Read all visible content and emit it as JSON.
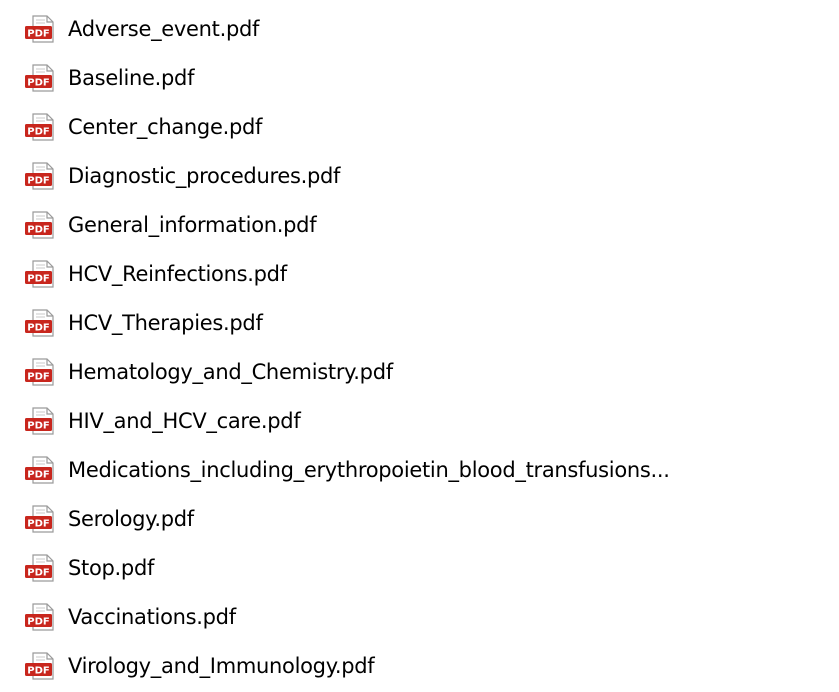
{
  "files": [
    {
      "name": "Adverse_event.pdf",
      "icon": "pdf-file-icon"
    },
    {
      "name": "Baseline.pdf",
      "icon": "pdf-file-icon"
    },
    {
      "name": "Center_change.pdf",
      "icon": "pdf-file-icon"
    },
    {
      "name": "Diagnostic_procedures.pdf",
      "icon": "pdf-file-icon"
    },
    {
      "name": "General_information.pdf",
      "icon": "pdf-file-icon"
    },
    {
      "name": "HCV_Reinfections.pdf",
      "icon": "pdf-file-icon"
    },
    {
      "name": "HCV_Therapies.pdf",
      "icon": "pdf-file-icon"
    },
    {
      "name": "Hematology_and_Chemistry.pdf",
      "icon": "pdf-file-icon"
    },
    {
      "name": "HIV_and_HCV_care.pdf",
      "icon": "pdf-file-icon"
    },
    {
      "name": "Medications_including_erythropoietin_blood_transfusions...",
      "icon": "pdf-file-icon"
    },
    {
      "name": "Serology.pdf",
      "icon": "pdf-file-icon"
    },
    {
      "name": "Stop.pdf",
      "icon": "pdf-file-icon"
    },
    {
      "name": "Vaccinations.pdf",
      "icon": "pdf-file-icon"
    },
    {
      "name": "Virology_and_Immunology.pdf",
      "icon": "pdf-file-icon"
    }
  ],
  "icon_label": "PDF",
  "colors": {
    "pdf_red": "#c8261d",
    "page_gray": "#9a9a9a",
    "text": "#000000"
  }
}
